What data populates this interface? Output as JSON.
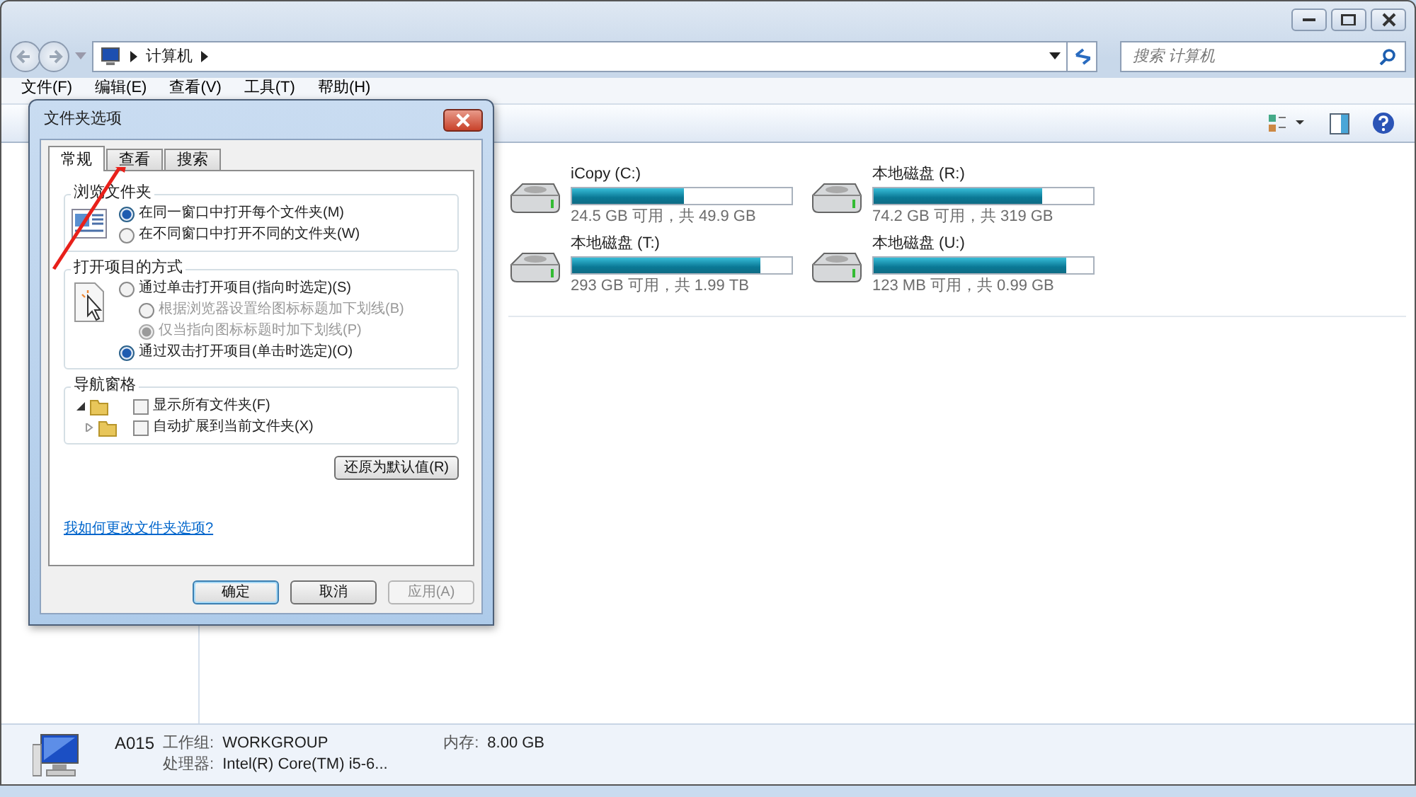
{
  "address_bar": {
    "breadcrumb": [
      "计算机"
    ]
  },
  "search": {
    "placeholder": "搜索 计算机"
  },
  "menu": [
    "文件(F)",
    "编辑(E)",
    "查看(V)",
    "工具(T)",
    "帮助(H)"
  ],
  "drives": [
    {
      "name": "iCopy (C:)",
      "level": 0.51,
      "info": "24.5 GB 可用，共 49.9 GB"
    },
    {
      "name": "本地磁盘 (R:)",
      "level": 0.77,
      "info": "74.2 GB 可用，共 319 GB"
    },
    {
      "name": "本地磁盘 (T:)",
      "level": 0.86,
      "info": "293 GB 可用，共 1.99 TB"
    },
    {
      "name": "本地磁盘 (U:)",
      "level": 0.88,
      "info": "123 MB 可用，共 0.99 GB"
    }
  ],
  "status_bar": {
    "computer": "A015",
    "fields": [
      {
        "label": "工作组:",
        "value": "WORKGROUP"
      },
      {
        "label": "内存:",
        "value": "8.00 GB"
      },
      {
        "label": "处理器:",
        "value": "Intel(R) Core(TM) i5-6..."
      }
    ]
  },
  "dialog": {
    "title": "文件夹选项",
    "tabs": [
      {
        "label": "常规",
        "selected": true
      },
      {
        "label": "查看",
        "selected": false
      },
      {
        "label": "搜索",
        "selected": false
      }
    ],
    "groups": [
      {
        "title": "浏览文件夹",
        "kind": "radio",
        "options": [
          {
            "label": "在同一窗口中打开每个文件夹(M)",
            "selected": true,
            "disabled": false
          },
          {
            "label": "在不同窗口中打开不同的文件夹(W)",
            "selected": false,
            "disabled": false
          }
        ]
      },
      {
        "title": "打开项目的方式",
        "kind": "radio",
        "options": [
          {
            "label": "通过单击打开项目(指向时选定)(S)",
            "selected": false,
            "disabled": false,
            "children": [
              {
                "label": "根据浏览器设置给图标标题加下划线(B)",
                "selected": false,
                "disabled": true
              },
              {
                "label": "仅当指向图标标题时加下划线(P)",
                "selected": true,
                "disabled": true
              }
            ]
          },
          {
            "label": "通过双击打开项目(单击时选定)(O)",
            "selected": true,
            "disabled": false
          }
        ]
      },
      {
        "title": "导航窗格",
        "kind": "tree",
        "options": [
          {
            "label": "显示所有文件夹(F)",
            "checked": false,
            "expanded": true
          },
          {
            "label": "自动扩展到当前文件夹(X)",
            "checked": false,
            "expanded": false
          }
        ]
      }
    ],
    "restore_button": "还原为默认值(R)",
    "help_link": "我如何更改文件夹选项?",
    "buttons": [
      {
        "label": "确定",
        "disabled": false,
        "default": true
      },
      {
        "label": "取消",
        "disabled": false,
        "default": false
      },
      {
        "label": "应用(A)",
        "disabled": true,
        "default": false
      }
    ]
  }
}
